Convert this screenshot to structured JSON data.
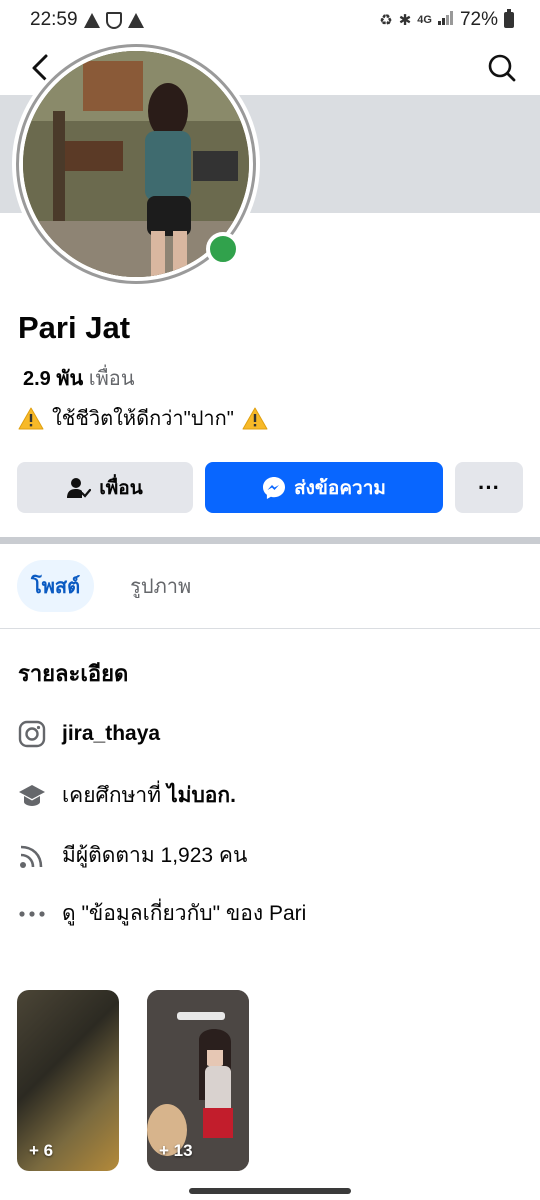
{
  "status_bar": {
    "time": "22:59",
    "network": "4G",
    "battery": "72%"
  },
  "profile": {
    "name": "Pari Jat",
    "friends_count": "2.9 พัน",
    "friends_label": "เพื่อน",
    "bio": "ใช้ชีวิตให้ดีกว่า\"ปาก\"",
    "online": true,
    "online_color": "#31a24c"
  },
  "actions": {
    "friend_label": "เพื่อน",
    "message_label": "ส่งข้อความ",
    "more_label": "···"
  },
  "tabs": [
    {
      "label": "โพสต์",
      "active": true
    },
    {
      "label": "รูปภาพ",
      "active": false
    }
  ],
  "details": {
    "title": "รายละเอียด",
    "instagram": "jira_thaya",
    "education_prefix": "เคยศึกษาที่",
    "education_value": "ไม่บอก.",
    "followers": "มีผู้ติดตาม 1,923 คน",
    "about": "ดู \"ข้อมูลเกี่ยวกับ\" ของ Pari"
  },
  "photos": [
    {
      "count": "+ 6"
    },
    {
      "count": "+ 13"
    }
  ],
  "colors": {
    "accent": "#0866ff",
    "tab_active_text": "#0a5ac2",
    "tab_active_bg": "#ebf5ff"
  }
}
